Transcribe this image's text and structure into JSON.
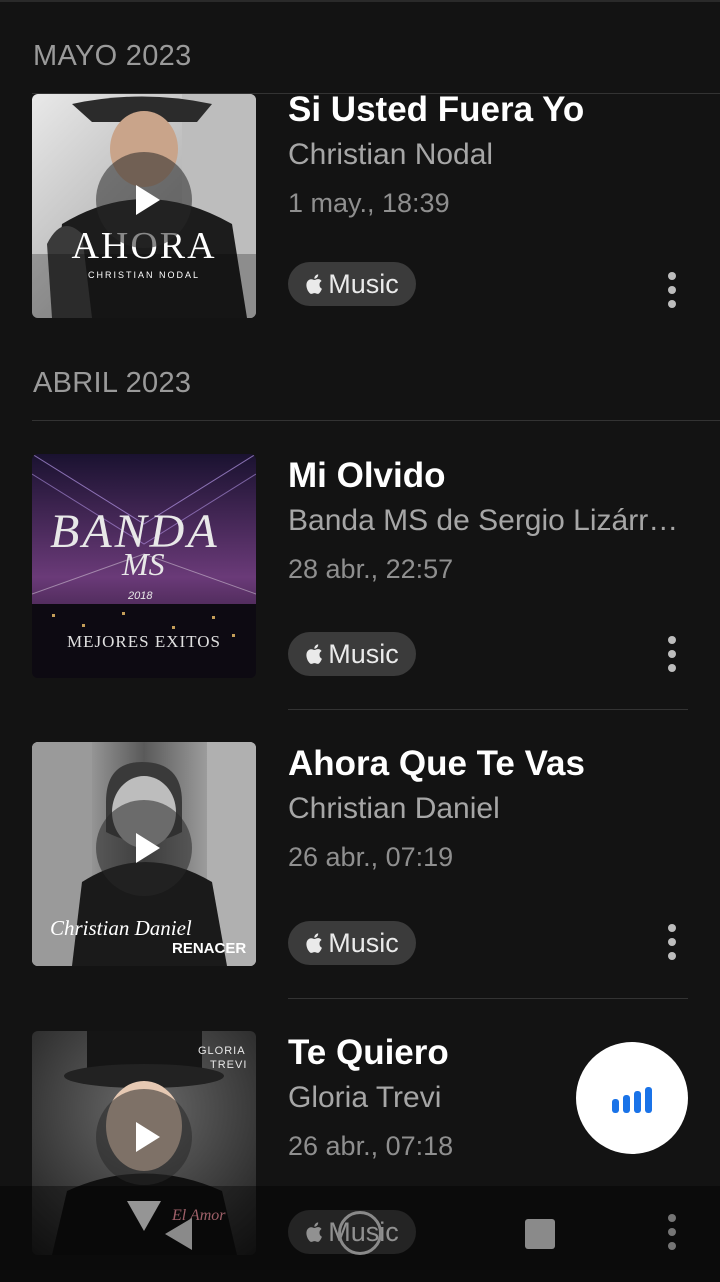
{
  "sections": [
    {
      "header": "MAYO 2023",
      "items": [
        {
          "title": "Si Usted Fuera Yo",
          "artist": "Christian Nodal",
          "date": "1 may., 18:39",
          "service": "Music",
          "art_text": "AHORA",
          "art_sub": "CHRISTIAN NODAL"
        }
      ]
    },
    {
      "header": "ABRIL 2023",
      "items": [
        {
          "title": "Mi Olvido",
          "artist": "Banda MS de Sergio Lizárraga",
          "date": "28 abr., 22:57",
          "service": "Music",
          "art_text": "BANDA",
          "art_text2": "MS",
          "art_year": "2018",
          "art_sub": "MEJORES EXITOS"
        },
        {
          "title": "Ahora Que Te Vas",
          "artist": "Christian Daniel",
          "date": "26 abr., 07:19",
          "service": "Music",
          "art_text": "Christian Daniel",
          "art_sub": "RENACER"
        },
        {
          "title": "Te Quiero",
          "artist": "Gloria Trevi",
          "date": "26 abr., 07:18",
          "service": "Music",
          "art_text": "GLORIA",
          "art_text2": "TREVI",
          "art_sub": "El Amor"
        }
      ]
    }
  ],
  "colors": {
    "background": "#131313",
    "accent": "#1a73e8",
    "badge": "#3b3b3b"
  },
  "icons": {
    "fab": "equalizer-bars-icon",
    "more": "more-vertical-icon",
    "play": "play-icon",
    "service": "apple-logo-icon"
  }
}
